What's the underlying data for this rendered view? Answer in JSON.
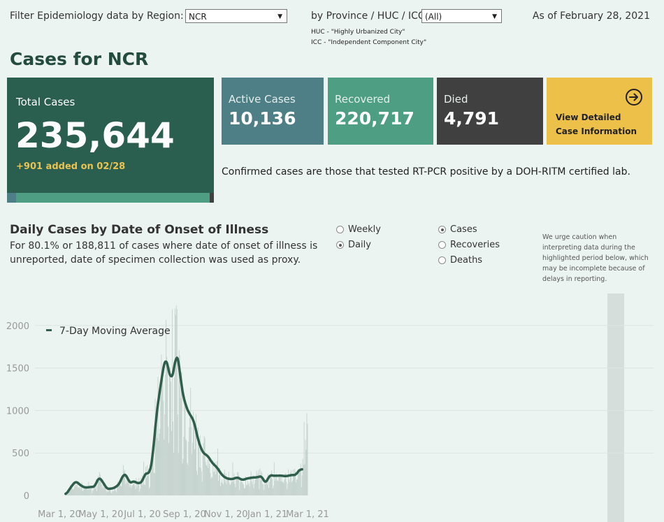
{
  "filters": {
    "region_label": "Filter Epidemiology data by Region:",
    "region_value": "NCR",
    "province_label": "by Province / HUC / ICC:",
    "province_value": "(All)",
    "huc_note": "HUC - \"Highly Urbanized City\"",
    "icc_note": "ICC - \"Independent Component City\""
  },
  "as_of": "As of February 28, 2021",
  "page_title": "Cases for NCR",
  "cards": {
    "total": {
      "label": "Total Cases",
      "value": "235,644",
      "delta": "+901 added on 02/28"
    },
    "active": {
      "label": "Active Cases",
      "value": "10,136"
    },
    "recovered": {
      "label": "Recovered",
      "value": "220,717"
    },
    "died": {
      "label": "Died",
      "value": "4,791"
    },
    "detail": {
      "label_line1": "View Detailed",
      "label_line2": "Case Information",
      "icon": "arrow-circle-right-icon"
    }
  },
  "confirmed_note": "Confirmed cases are those that tested RT-PCR positive by a DOH-RITM certified lab.",
  "section": {
    "title": "Daily Cases by Date of Onset of Illness",
    "desc_line1": "For 80.1% or 188,811 of cases where date of onset of illness is",
    "desc_line2": "unreported, date of specimen collection was used as proxy.",
    "caution": [
      "We urge caution when",
      "interpreting data during the",
      "highlighted period below, which",
      "may be incomplete because of",
      "delays in reporting."
    ]
  },
  "options": {
    "period": [
      {
        "label": "Weekly",
        "selected": false
      },
      {
        "label": "Daily",
        "selected": true
      }
    ],
    "metric": [
      {
        "label": "Cases",
        "selected": true
      },
      {
        "label": "Recoveries",
        "selected": false
      },
      {
        "label": "Deaths",
        "selected": false
      }
    ]
  },
  "colors": {
    "total_card": "#2a5e4f",
    "active_card": "#4f7f86",
    "recovered_card": "#4e9e83",
    "died_card": "#404040",
    "detail_card": "#edc04a",
    "ma_line": "#2f5e4b",
    "bars": "#c3d1cc",
    "highlight": "#d5dedb"
  },
  "chart_data": {
    "type": "bar",
    "legend": "7-Day Moving Average",
    "x_ticks": [
      "Mar 1, 20",
      "May 1, 20",
      "Jul 1, 20",
      "Sep 1, 20",
      "Nov 1, 20",
      "Jan 1, 21",
      "Mar 1, 21"
    ],
    "y_ticks": [
      "0",
      "500",
      "1000",
      "1500",
      "2000"
    ],
    "ylim": [
      0,
      2300
    ],
    "series": [
      {
        "name": "7-Day Moving Average",
        "points": [
          [
            "2020-03-10",
            0
          ],
          [
            "2020-03-18",
            100
          ],
          [
            "2020-03-25",
            170
          ],
          [
            "2020-04-01",
            120
          ],
          [
            "2020-04-08",
            90
          ],
          [
            "2020-04-15",
            100
          ],
          [
            "2020-04-22",
            100
          ],
          [
            "2020-04-28",
            220
          ],
          [
            "2020-05-03",
            170
          ],
          [
            "2020-05-10",
            75
          ],
          [
            "2020-05-20",
            85
          ],
          [
            "2020-05-28",
            130
          ],
          [
            "2020-06-03",
            250
          ],
          [
            "2020-06-08",
            240
          ],
          [
            "2020-06-12",
            140
          ],
          [
            "2020-06-18",
            170
          ],
          [
            "2020-06-25",
            140
          ],
          [
            "2020-07-01",
            160
          ],
          [
            "2020-07-06",
            280
          ],
          [
            "2020-07-11",
            240
          ],
          [
            "2020-07-16",
            420
          ],
          [
            "2020-07-21",
            900
          ],
          [
            "2020-07-26",
            1200
          ],
          [
            "2020-07-31",
            1450
          ],
          [
            "2020-08-04",
            1650
          ],
          [
            "2020-08-08",
            1500
          ],
          [
            "2020-08-12",
            1350
          ],
          [
            "2020-08-17",
            1480
          ],
          [
            "2020-08-20",
            1710
          ],
          [
            "2020-08-24",
            1550
          ],
          [
            "2020-08-28",
            1250
          ],
          [
            "2020-09-03",
            1050
          ],
          [
            "2020-09-09",
            950
          ],
          [
            "2020-09-15",
            880
          ],
          [
            "2020-09-21",
            650
          ],
          [
            "2020-09-28",
            500
          ],
          [
            "2020-10-05",
            470
          ],
          [
            "2020-10-12",
            380
          ],
          [
            "2020-10-19",
            330
          ],
          [
            "2020-10-26",
            240
          ],
          [
            "2020-11-02",
            200
          ],
          [
            "2020-11-10",
            190
          ],
          [
            "2020-11-18",
            215
          ],
          [
            "2020-11-25",
            180
          ],
          [
            "2020-12-02",
            200
          ],
          [
            "2020-12-10",
            210
          ],
          [
            "2020-12-18",
            215
          ],
          [
            "2020-12-24",
            230
          ],
          [
            "2020-12-29",
            130
          ],
          [
            "2021-01-04",
            240
          ],
          [
            "2021-01-12",
            230
          ],
          [
            "2021-01-20",
            235
          ],
          [
            "2021-01-28",
            225
          ],
          [
            "2021-02-05",
            240
          ],
          [
            "2021-02-12",
            240
          ],
          [
            "2021-02-18",
            315
          ],
          [
            "2021-02-21",
            300
          ]
        ]
      }
    ]
  }
}
